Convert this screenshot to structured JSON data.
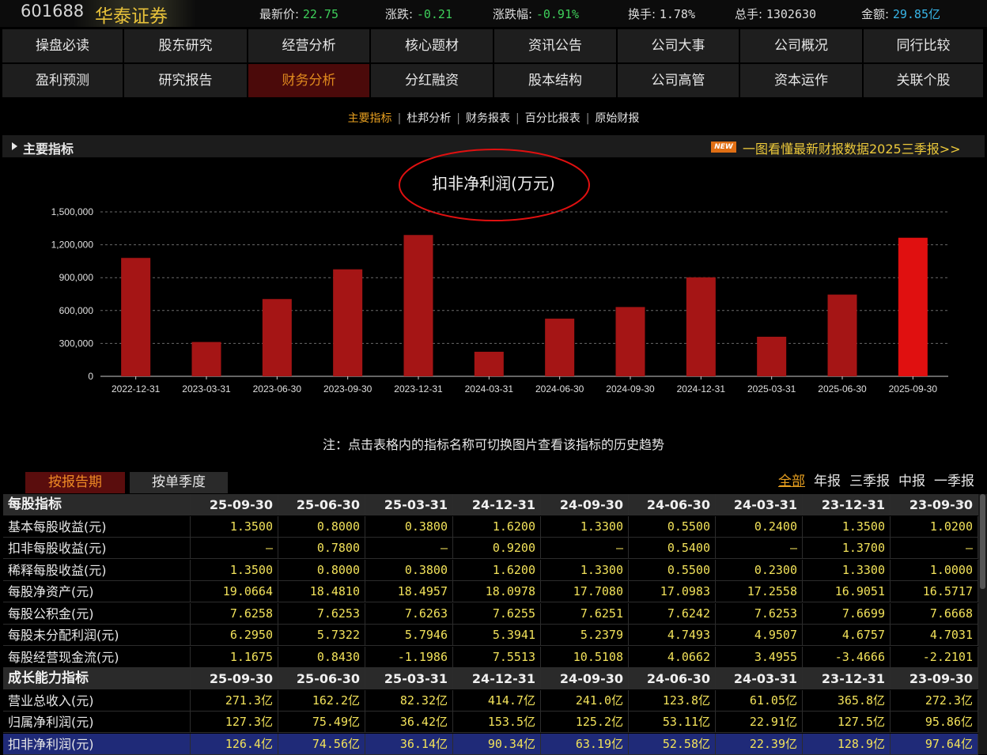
{
  "quote": {
    "code": "601688",
    "name": "华泰证券",
    "latest_label": "最新价:",
    "latest_value": "22.75",
    "change_label": "涨跌:",
    "change_value": "-0.21",
    "change_pct_label": "涨跌幅:",
    "change_pct_value": "-0.91%",
    "turnover_label": "换手:",
    "turnover_value": "1.78%",
    "volume_label": "总手:",
    "volume_value": "1302630",
    "amount_label": "金额:",
    "amount_value": "29.85亿"
  },
  "nav": {
    "row1": [
      "操盘必读",
      "股东研究",
      "经营分析",
      "核心题材",
      "资讯公告",
      "公司大事",
      "公司概况",
      "同行比较"
    ],
    "row2": [
      "盈利预测",
      "研究报告",
      "财务分析",
      "分红融资",
      "股本结构",
      "公司高管",
      "资本运作",
      "关联个股"
    ],
    "active": "财务分析"
  },
  "subnav": {
    "items": [
      "主要指标",
      "杜邦分析",
      "财务报表",
      "百分比报表",
      "原始财报"
    ],
    "active": "主要指标",
    "separator": "|"
  },
  "section": {
    "title": "主要指标",
    "new_badge": "NEW",
    "promo_link": "一图看懂最新财报数据2025三季报>>"
  },
  "chart_data": {
    "type": "bar",
    "title": "扣非净利润(万元)",
    "categories": [
      "2022-12-31",
      "2023-03-31",
      "2023-06-30",
      "2023-09-30",
      "2023-12-31",
      "2024-03-31",
      "2024-06-30",
      "2024-09-30",
      "2024-12-31",
      "2025-03-31",
      "2025-06-30",
      "2025-09-30"
    ],
    "values": [
      1080000,
      313000,
      705000,
      976000,
      1289000,
      224000,
      526000,
      632000,
      903000,
      361000,
      745600,
      1264000
    ],
    "yticks": [
      "0",
      "300,000",
      "600,000",
      "900,000",
      "1,200,000",
      "1,500,000"
    ],
    "ylim": [
      0,
      1500000
    ],
    "grid": true,
    "bar_color": "#a51515",
    "highlight_color": "#e01010"
  },
  "note": "注：点击表格内的指标名称可切换图片查看该指标的历史趋势",
  "tabs": {
    "by_period": "按报告期",
    "by_quarter": "按单季度"
  },
  "filters": [
    "全部",
    "年报",
    "三季报",
    "中报",
    "一季报"
  ],
  "filter_active": "全部",
  "table": {
    "periods": [
      "25-09-30",
      "25-06-30",
      "25-03-31",
      "24-12-31",
      "24-09-30",
      "24-06-30",
      "24-03-31",
      "23-12-31",
      "23-09-30"
    ],
    "groups": [
      {
        "title": "每股指标",
        "rows": [
          {
            "label": "基本每股收益(元)",
            "values": [
              "1.3500",
              "0.8000",
              "0.3800",
              "1.6200",
              "1.3300",
              "0.5500",
              "0.2400",
              "1.3500",
              "1.0200"
            ]
          },
          {
            "label": "扣非每股收益(元)",
            "values": [
              "—",
              "0.7800",
              "—",
              "0.9200",
              "—",
              "0.5400",
              "—",
              "1.3700",
              "—"
            ]
          },
          {
            "label": "稀释每股收益(元)",
            "values": [
              "1.3500",
              "0.8000",
              "0.3800",
              "1.6200",
              "1.3300",
              "0.5500",
              "0.2300",
              "1.3300",
              "1.0000"
            ]
          },
          {
            "label": "每股净资产(元)",
            "values": [
              "19.0664",
              "18.4810",
              "18.4957",
              "18.0978",
              "17.7080",
              "17.0983",
              "17.2558",
              "16.9051",
              "16.5717"
            ]
          },
          {
            "label": "每股公积金(元)",
            "values": [
              "7.6258",
              "7.6253",
              "7.6263",
              "7.6255",
              "7.6251",
              "7.6242",
              "7.6253",
              "7.6699",
              "7.6668"
            ]
          },
          {
            "label": "每股未分配利润(元)",
            "values": [
              "6.2950",
              "5.7322",
              "5.7946",
              "5.3941",
              "5.2379",
              "4.7493",
              "4.9507",
              "4.6757",
              "4.7031"
            ]
          },
          {
            "label": "每股经营现金流(元)",
            "values": [
              "1.1675",
              "0.8430",
              "-1.1986",
              "7.5513",
              "10.5108",
              "4.0662",
              "3.4955",
              "-3.4666",
              "-2.2101"
            ]
          }
        ]
      },
      {
        "title": "成长能力指标",
        "rows": [
          {
            "label": "营业总收入(元)",
            "values": [
              "271.3亿",
              "162.2亿",
              "82.32亿",
              "414.7亿",
              "241.0亿",
              "123.8亿",
              "61.05亿",
              "365.8亿",
              "272.3亿"
            ]
          },
          {
            "label": "归属净利润(元)",
            "values": [
              "127.3亿",
              "75.49亿",
              "36.42亿",
              "153.5亿",
              "125.2亿",
              "53.11亿",
              "22.91亿",
              "127.5亿",
              "95.86亿"
            ]
          },
          {
            "label": "扣非净利润(元)",
            "values": [
              "126.4亿",
              "74.56亿",
              "36.14亿",
              "90.34亿",
              "63.19亿",
              "52.58亿",
              "22.39亿",
              "128.9亿",
              "97.64亿"
            ],
            "highlight": true
          }
        ]
      }
    ]
  }
}
